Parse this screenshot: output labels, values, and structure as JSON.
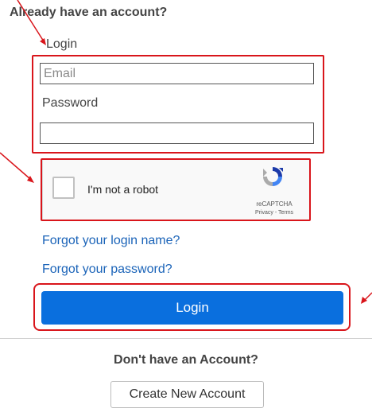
{
  "login_section": {
    "title": "Already have an account?",
    "login_label": "Login",
    "email_placeholder": "Email",
    "email_value": "",
    "password_label": "Password",
    "password_value": ""
  },
  "captcha": {
    "checkbox_label": "I'm not a robot",
    "brand": "reCAPTCHA",
    "links": "Privacy - Terms"
  },
  "links": {
    "forgot_login": "Forgot your login name?",
    "forgot_password": "Forgot your password?"
  },
  "login_button": {
    "label": "Login"
  },
  "signup_section": {
    "prompt": "Don't have an Account?",
    "create_button": "Create New Account"
  },
  "colors": {
    "primary_button": "#0a6fde",
    "link": "#1a63b8",
    "highlight": "#d9151b"
  },
  "icons": {
    "captcha_logo": "recaptcha-logo-icon",
    "annotation_arrows": "red-arrow-icon"
  }
}
